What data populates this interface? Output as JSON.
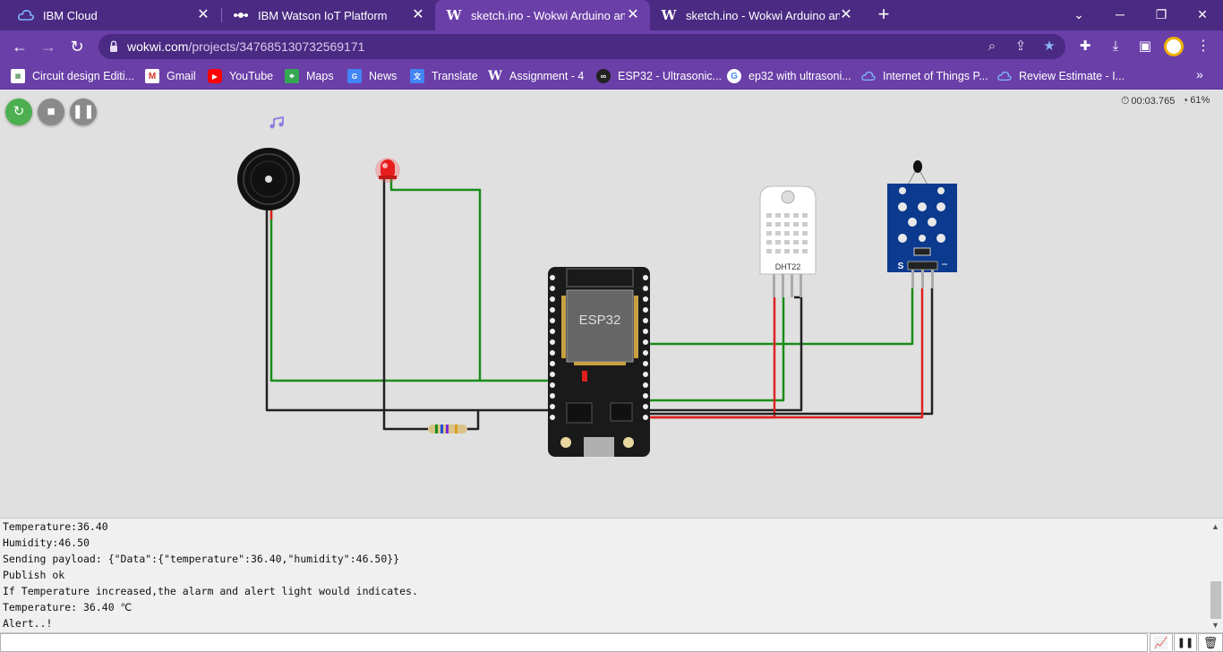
{
  "browser": {
    "tabs": [
      {
        "title": "IBM Cloud",
        "icon": "ibm-cloud-icon"
      },
      {
        "title": "IBM Watson IoT Platform",
        "icon": "watson-iot-icon"
      },
      {
        "title": "sketch.ino - Wokwi Arduino and E",
        "icon": "wokwi-icon",
        "active": true
      },
      {
        "title": "sketch.ino - Wokwi Arduino and E",
        "icon": "wokwi-icon"
      }
    ],
    "url_host": "wokwi.com",
    "url_path": "/projects/347685130732569171",
    "bookmarks": [
      {
        "label": "Circuit design Editi...",
        "icon": "circuit-icon"
      },
      {
        "label": "Gmail",
        "icon": "gmail-icon"
      },
      {
        "label": "YouTube",
        "icon": "youtube-icon"
      },
      {
        "label": "Maps",
        "icon": "maps-icon"
      },
      {
        "label": "News",
        "icon": "news-icon"
      },
      {
        "label": "Translate",
        "icon": "translate-icon"
      },
      {
        "label": "Assignment - 4",
        "icon": "wokwi-icon"
      },
      {
        "label": "ESP32 - Ultrasonic...",
        "icon": "esp32-icon"
      },
      {
        "label": "ep32 with ultrasoni...",
        "icon": "google-icon"
      },
      {
        "label": "Internet of Things P...",
        "icon": "ibm-cloud-icon"
      },
      {
        "label": "Review Estimate - I...",
        "icon": "ibm-cloud-icon"
      }
    ]
  },
  "simulator": {
    "timer": "00:03.765",
    "speed": "61%",
    "components": {
      "mcu_label": "ESP32",
      "sensor_label": "DHT22",
      "ntc_pin_s": "S",
      "ntc_pin_minus": "−"
    }
  },
  "serial": {
    "lines": [
      "Temperature:36.40",
      "Humidity:46.50",
      "Sending payload: {\"Data\":{\"temperature\":36.40,\"humidity\":46.50}}",
      "Publish ok",
      "If Temperature increased,the alarm and alert light would indicates.",
      "Temperature: 36.40 ℃",
      "Alert..!"
    ]
  },
  "colors": {
    "tab_bg": "#4a2a82",
    "toolbar_bg": "#6a3fa8",
    "wire_green": "#1a8c1a",
    "wire_red": "#e02020",
    "wire_black": "#222222",
    "esp32_board": "#1a1a1a",
    "dht_body": "#ffffff",
    "ntc_board": "#0b3a8f"
  }
}
